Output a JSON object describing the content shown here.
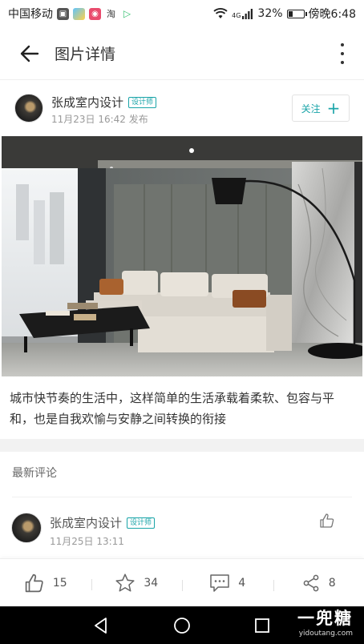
{
  "status_bar": {
    "carrier": "中国移动",
    "network": "4G",
    "battery": "32%",
    "battery_fraction": 0.32,
    "time": "傍晚6:48",
    "app_icons": [
      "photo-app-icon",
      "gallery-app-icon",
      "bunny-app-icon",
      "taobao-app-icon",
      "play-app-icon"
    ],
    "taobao_glyph": "淘"
  },
  "header": {
    "title": "图片详情"
  },
  "author": {
    "name": "张成室内设计",
    "badge": "设计师",
    "post_time": "11月23日 16:42 发布",
    "follow_label": "关注",
    "follow_symbol": "+"
  },
  "photo": {
    "subject": "living-room-interior"
  },
  "caption": "城市快节奏的生活中，这样简单的生活承载着柔软、包容与平和，也是自我欢愉与安静之间转换的衔接",
  "comments": {
    "section_title": "最新评论",
    "items": [
      {
        "name": "张成室内设计",
        "badge": "设计师",
        "time": "11月25日 13:11"
      }
    ]
  },
  "actions": {
    "likes": "15",
    "favorites": "34",
    "comments": "4",
    "shares": "8"
  },
  "watermark": {
    "brand": "一兜糖",
    "site": "yidoutang.com"
  },
  "colors": {
    "accent": "#19a4a8",
    "text": "#333333",
    "muted": "#999999",
    "nav_bar": "#000000"
  }
}
